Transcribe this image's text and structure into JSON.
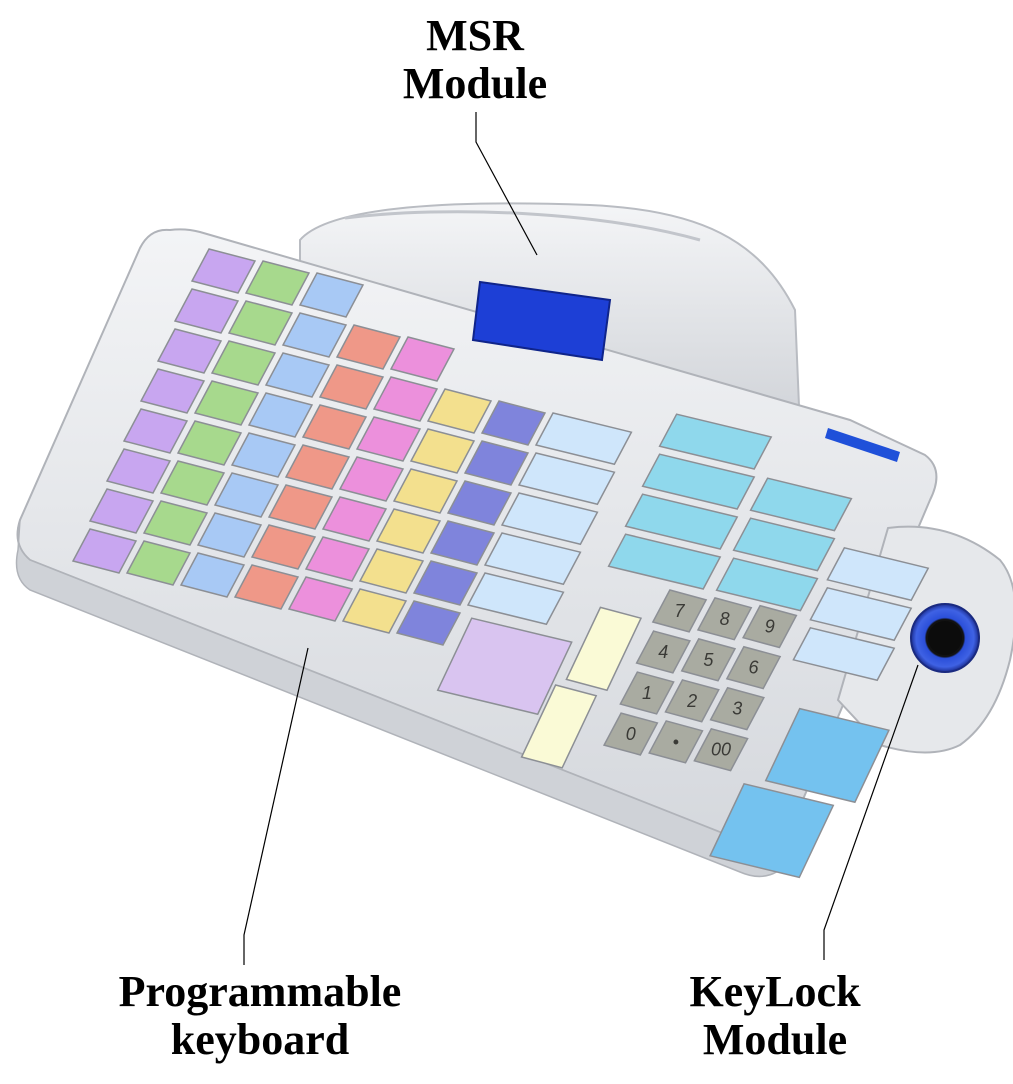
{
  "labels": {
    "msr": {
      "line1": "MSR",
      "line2": "Module"
    },
    "keyboard": {
      "line1": "Programmable",
      "line2": "keyboard"
    },
    "keylock": {
      "line1": "KeyLock",
      "line2": "Module"
    }
  },
  "numpad": {
    "keys": [
      "7",
      "8",
      "9",
      "4",
      "5",
      "6",
      "1",
      "2",
      "3",
      "0",
      "•",
      "00"
    ]
  },
  "colors": {
    "body": "#e9ebee",
    "body_shadow": "#c9ccd2",
    "display": "#1d3fd6",
    "keylock_ring": "#2b4fd9",
    "numpad_key": "#a9aba1",
    "key_purple": "#c8a6f0",
    "key_green": "#a7d98d",
    "key_blue": "#a8c9f5",
    "key_red": "#ef9888",
    "key_pink": "#ec90dc",
    "key_yellow": "#f3e08e",
    "key_violet": "#7f84dc",
    "key_lightblue": "#cfe6fb",
    "key_cyan": "#8fd8ec",
    "key_cream": "#fafad6",
    "key_sky": "#74c2ef",
    "key_lilac": "#d9c4f0",
    "badge": "#1f50d9"
  }
}
